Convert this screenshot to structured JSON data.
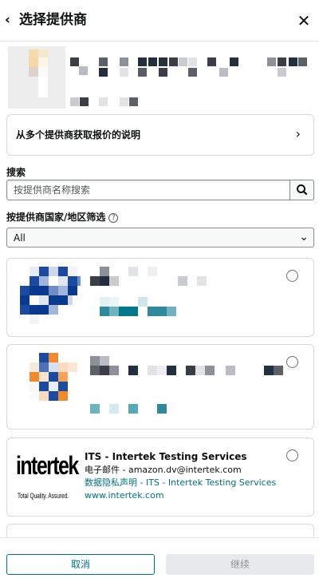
{
  "header": {
    "title": "选择提供商",
    "back_icon": "chevron-left-icon",
    "close_icon": "close-icon"
  },
  "info_card": {
    "label": "从多个提供商获取报价的说明",
    "chevron_icon": "chevron-right-icon"
  },
  "search": {
    "label": "搜索",
    "placeholder": "按提供商名称搜索",
    "value": "",
    "button_icon": "search-icon"
  },
  "filter": {
    "label": "按提供商国家/地区筛选",
    "help_icon": "help-icon",
    "selected": "All"
  },
  "providers": [
    {
      "name": "ITS - Intertek Testing Services",
      "email": "电子邮件 - amazon.dv@intertek.com",
      "privacy": "数据隐私声明 - ITS - Intertek Testing Services",
      "website": "www.intertek.com",
      "logo_text": "intertek",
      "logo_tagline": "Total Quality. Assured.",
      "selected": false
    }
  ],
  "footer": {
    "cancel_label": "取消",
    "continue_label": "继续",
    "continue_enabled": false
  },
  "colors": {
    "link": "#007185",
    "border": "#d5d9d9",
    "disabled_bg": "#e7e9ec",
    "disabled_text": "#8d9096"
  }
}
